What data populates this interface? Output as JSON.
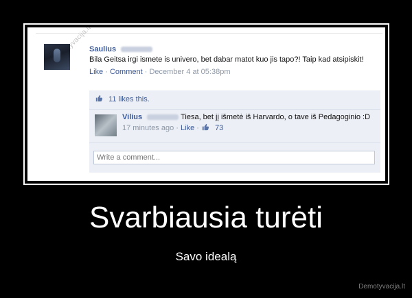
{
  "watermark": "Demotyvacija.lt",
  "post": {
    "author": "Saulius",
    "text": "Bila Geitsa irgi ismete is univero, bet dabar matot kuo jis tapo?! Taip kad atsipiskit!",
    "like_label": "Like",
    "separator": "·",
    "comment_label": "Comment",
    "timestamp": "December 4 at 05:38pm",
    "likes_text": "11 likes this."
  },
  "comment": {
    "author": "Vilius",
    "text": "Tiesa, bet jį išmetė iš Harvardo, o tave iš Pedagoginio :D",
    "timestamp": "17 minutes ago",
    "separator": "·",
    "like_label": "Like",
    "separator2": "·",
    "likes": "73"
  },
  "composer": {
    "placeholder": "Write a comment..."
  },
  "caption": {
    "title": "Svarbiausia turėti",
    "subtitle": "Savo idealą"
  },
  "site": "Demotyvacija.lt",
  "colors": {
    "background": "#000000",
    "facebook_blue": "#3b5998",
    "panel": "#eceff5"
  }
}
